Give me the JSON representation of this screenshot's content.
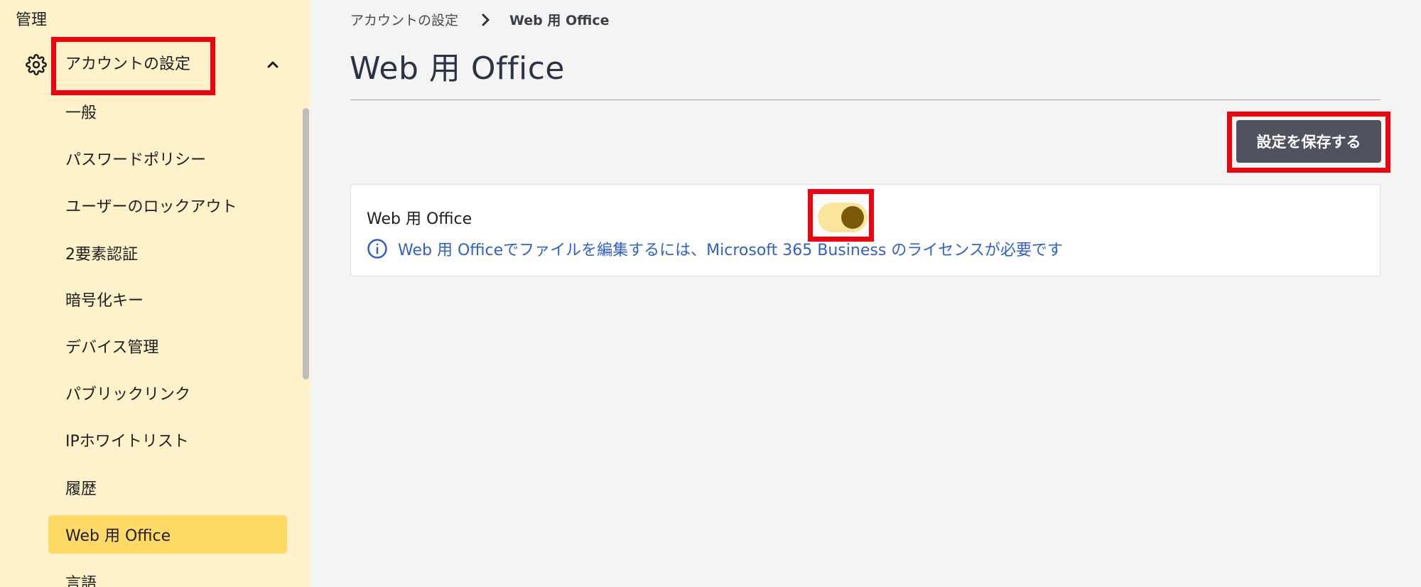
{
  "sidebar": {
    "title": "管理",
    "section": {
      "label": "アカウントの設定",
      "icon": "gear-icon",
      "toggle_icon": "chevron-up-icon"
    },
    "items": [
      {
        "label": "一般"
      },
      {
        "label": "パスワードポリシー"
      },
      {
        "label": "ユーザーのロックアウト"
      },
      {
        "label": "2要素認証"
      },
      {
        "label": "暗号化キー"
      },
      {
        "label": "デバイス管理"
      },
      {
        "label": "パブリックリンク"
      },
      {
        "label": "IPホワイトリスト"
      },
      {
        "label": "履歴"
      },
      {
        "label": "Web 用 Office",
        "active": true
      },
      {
        "label": "言語"
      }
    ]
  },
  "breadcrumb": {
    "parent": "アカウントの設定",
    "current": "Web 用 Office"
  },
  "page": {
    "title": "Web 用 Office",
    "save_label": "設定を保存する"
  },
  "setting": {
    "label": "Web 用 Office",
    "enabled": true,
    "info": "Web 用 Officeでファイルを編集するには、Microsoft 365 Business のライセンスが必要です"
  },
  "colors": {
    "sidebar_bg": "#fff1c9",
    "active_item": "#ffd966",
    "highlight": "#f2000e",
    "save_button": "#50535e",
    "toggle_track": "#fbe59a",
    "toggle_knob": "#7a5a08",
    "info_text": "#2f5fd6"
  }
}
